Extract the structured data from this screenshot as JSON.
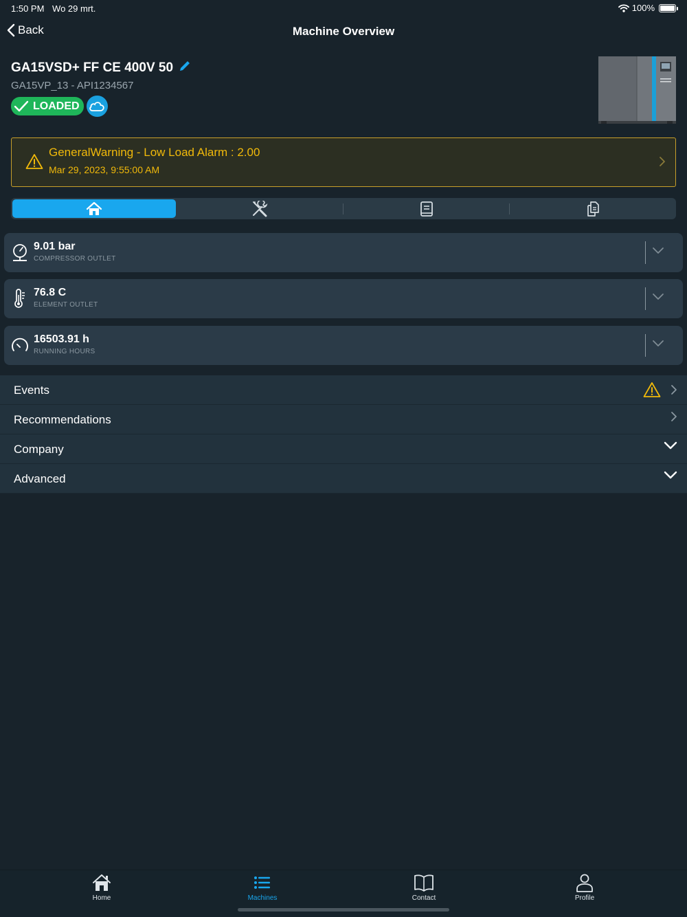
{
  "status_bar": {
    "time": "1:50 PM",
    "date": "Wo 29 mrt.",
    "battery": "100%"
  },
  "nav": {
    "back_label": "Back",
    "title": "Machine Overview"
  },
  "machine": {
    "name": "GA15VSD+ FF CE 400V 50",
    "subtitle": "GA15VP_13 - API1234567",
    "status": "LOADED",
    "accent": "#19a7ee",
    "status_color": "#1fb65a"
  },
  "alarm": {
    "title": "GeneralWarning - Low Load Alarm : 2.00",
    "time": "Mar 29, 2023, 9:55:00 AM",
    "color": "#f1b90a"
  },
  "segments": [
    {
      "icon": "home-icon",
      "active": true
    },
    {
      "icon": "tools-icon",
      "active": false
    },
    {
      "icon": "manual-icon",
      "active": false
    },
    {
      "icon": "documents-icon",
      "active": false
    }
  ],
  "metrics": [
    {
      "value": "9.01 bar",
      "label": "COMPRESSOR OUTLET",
      "icon": "pressure-gauge-icon"
    },
    {
      "value": "76.8 C",
      "label": "ELEMENT OUTLET",
      "icon": "thermometer-icon"
    },
    {
      "value": "16503.91 h",
      "label": "RUNNING HOURS",
      "icon": "speedometer-icon"
    }
  ],
  "sections": [
    {
      "label": "Events",
      "warning": true,
      "type": "link"
    },
    {
      "label": "Recommendations",
      "warning": false,
      "type": "link"
    },
    {
      "label": "Company",
      "warning": false,
      "type": "expand"
    },
    {
      "label": "Advanced",
      "warning": false,
      "type": "expand"
    }
  ],
  "tabs": [
    {
      "label": "Home",
      "icon": "house-icon",
      "active": false
    },
    {
      "label": "Machines",
      "icon": "list-icon",
      "active": true
    },
    {
      "label": "Contact",
      "icon": "book-icon",
      "active": false
    },
    {
      "label": "Profile",
      "icon": "person-icon",
      "active": false
    }
  ]
}
